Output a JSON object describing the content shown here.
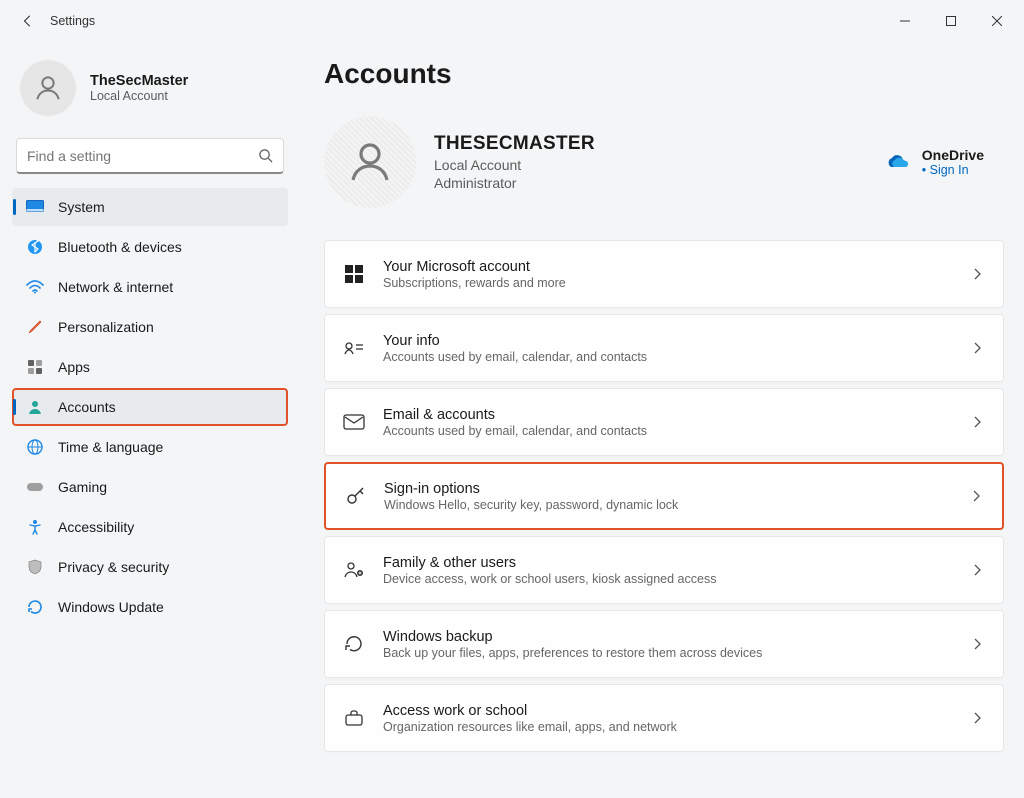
{
  "window": {
    "title": "Settings"
  },
  "profile": {
    "name": "TheSecMaster",
    "sub": "Local Account"
  },
  "search": {
    "placeholder": "Find a setting"
  },
  "nav": {
    "system": "System",
    "bluetooth": "Bluetooth & devices",
    "network": "Network & internet",
    "personalization": "Personalization",
    "apps": "Apps",
    "accounts": "Accounts",
    "time": "Time & language",
    "gaming": "Gaming",
    "accessibility": "Accessibility",
    "privacy": "Privacy & security",
    "update": "Windows Update"
  },
  "page": {
    "title": "Accounts",
    "account_name": "THESECMASTER",
    "account_type": "Local Account",
    "account_role": "Administrator",
    "onedrive_label": "OneDrive",
    "onedrive_link": "Sign In"
  },
  "cards": {
    "ms": {
      "title": "Your Microsoft account",
      "sub": "Subscriptions, rewards and more"
    },
    "info": {
      "title": "Your info",
      "sub": "Accounts used by email, calendar, and contacts"
    },
    "email": {
      "title": "Email & accounts",
      "sub": "Accounts used by email, calendar, and contacts"
    },
    "signin": {
      "title": "Sign-in options",
      "sub": "Windows Hello, security key, password, dynamic lock"
    },
    "family": {
      "title": "Family & other users",
      "sub": "Device access, work or school users, kiosk assigned access"
    },
    "backup": {
      "title": "Windows backup",
      "sub": "Back up your files, apps, preferences to restore them across devices"
    },
    "work": {
      "title": "Access work or school",
      "sub": "Organization resources like email, apps, and network"
    }
  }
}
